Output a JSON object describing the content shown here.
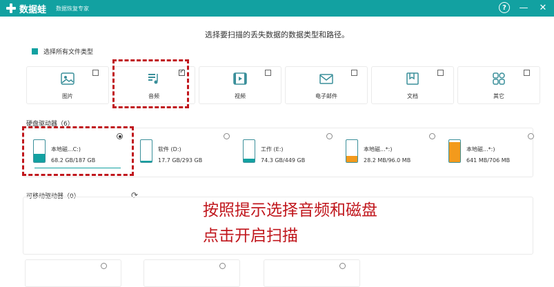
{
  "app": {
    "name": "数据蛙",
    "subtitle": "数据恢复专家"
  },
  "window_controls": {
    "help": "?",
    "minimize": "—",
    "close": "✕"
  },
  "headline": "选择要扫描的丢失数据的数据类型和路径。",
  "select_all_label": "选择所有文件类型",
  "file_types": [
    {
      "label": "图片",
      "icon": "image-icon",
      "checked": false
    },
    {
      "label": "音频",
      "icon": "audio-icon",
      "checked": true
    },
    {
      "label": "视频",
      "icon": "video-icon",
      "checked": false
    },
    {
      "label": "电子邮件",
      "icon": "email-icon",
      "checked": false
    },
    {
      "label": "文档",
      "icon": "document-icon",
      "checked": false
    },
    {
      "label": "其它",
      "icon": "other-icon",
      "checked": false
    }
  ],
  "hard_drives": {
    "title": "硬盘驱动器（6）",
    "items": [
      {
        "name": "本地磁...C:)",
        "size": "68.2 GB/187 GB",
        "selected": true,
        "fill": 0.36,
        "color": "#12a1a1"
      },
      {
        "name": "软件 (D:)",
        "size": "17.7 GB/293 GB",
        "selected": false,
        "fill": 0.06,
        "color": "#12a1a1"
      },
      {
        "name": "工作 (E:)",
        "size": "74.3 GB/449 GB",
        "selected": false,
        "fill": 0.17,
        "color": "#12a1a1"
      },
      {
        "name": "本地磁...*:)",
        "size": "28.2 MB/96.0 MB",
        "selected": false,
        "fill": 0.29,
        "color": "#f39a1c"
      },
      {
        "name": "本地磁...*:)",
        "size": "641 MB/706 MB",
        "selected": false,
        "fill": 0.91,
        "color": "#f39a1c"
      }
    ]
  },
  "removable": {
    "title": "可移动驱动器（0）",
    "refresh": "⟳"
  },
  "annotation": {
    "line1": "按照提示选择音频和磁盘",
    "line2": "点击开启扫描"
  },
  "colors": {
    "brand": "#12a1a1",
    "highlight": "#c0161c",
    "warning": "#f39a1c"
  }
}
